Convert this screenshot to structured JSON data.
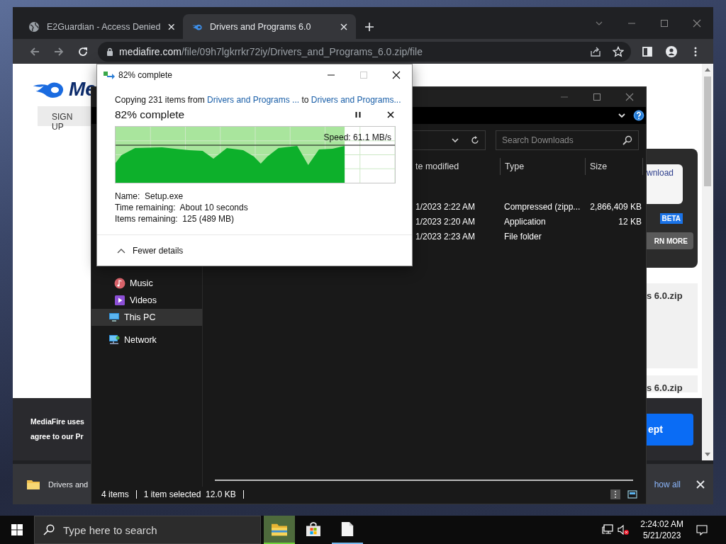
{
  "browser": {
    "tabs": [
      {
        "title": "E2Guardian - Access Denied",
        "kind": "globe",
        "selected": false
      },
      {
        "title": "Drivers and Programs 6.0",
        "kind": "mediafire",
        "selected": true
      }
    ],
    "url_host": "mediafire.com",
    "url_path": "/file/09h7lgkrrkr72iy/Drivers_and_Programs_6.0.zip/file"
  },
  "page": {
    "logo_text": "Me",
    "signup": "SIGN UP",
    "download_button": "wnload",
    "beta_badge": "BETA",
    "learn_more": "RN MORE",
    "file_cards": [
      "s 6.0.zip",
      "s 6.0.zip"
    ],
    "cookie_lines": [
      "MediaFire uses",
      "agree to our Pr"
    ],
    "accept_button": "ept"
  },
  "download_bar": {
    "file": "Drivers and",
    "show_all": "how all"
  },
  "explorer": {
    "search_placeholder": "Search Downloads",
    "columns": [
      "te modified",
      "Type",
      "Size"
    ],
    "rows": [
      {
        "date": "1/2023 2:22 AM",
        "type": "Compressed (zipp...",
        "size": "2,866,409 KB"
      },
      {
        "date": "1/2023 2:20 AM",
        "type": "Application",
        "size": "12 KB"
      },
      {
        "date": "1/2023 2:23 AM",
        "type": "File folder",
        "size": ""
      }
    ],
    "nav": [
      {
        "label": "Music",
        "kind": "music",
        "selected": false
      },
      {
        "label": "Videos",
        "kind": "videos",
        "selected": false
      },
      {
        "label": "This PC",
        "kind": "pc",
        "selected": true
      },
      {
        "label": "Network",
        "kind": "network",
        "selected": false
      }
    ],
    "status": {
      "count": "4 items",
      "selection": "1 item selected",
      "size": "12.0 KB"
    }
  },
  "copy_dialog": {
    "title": "82% complete",
    "copying_prefix": "Copying 231 items from",
    "source": "Drivers and Programs ...",
    "to_word": "to",
    "destination": "Drivers and Programs...",
    "heading": "82% complete",
    "level": 0.82,
    "speed": "Speed: 61.1 MB/s",
    "details": [
      {
        "label": "Name:",
        "value": "Setup.exe"
      },
      {
        "label": "Time remaining:",
        "value": "About 10 seconds"
      },
      {
        "label": "Items remaining:",
        "value": "125 (489 MB)"
      }
    ],
    "toggle": "Fewer details"
  },
  "taskbar": {
    "search_placeholder": "Type here to search",
    "apps": [
      {
        "kind": "explorer",
        "active": true,
        "running": true
      },
      {
        "kind": "store",
        "active": false,
        "running": false
      },
      {
        "kind": "document",
        "active": false,
        "running": true
      }
    ],
    "time": "2:24:02 AM",
    "date": "5/21/2023"
  }
}
